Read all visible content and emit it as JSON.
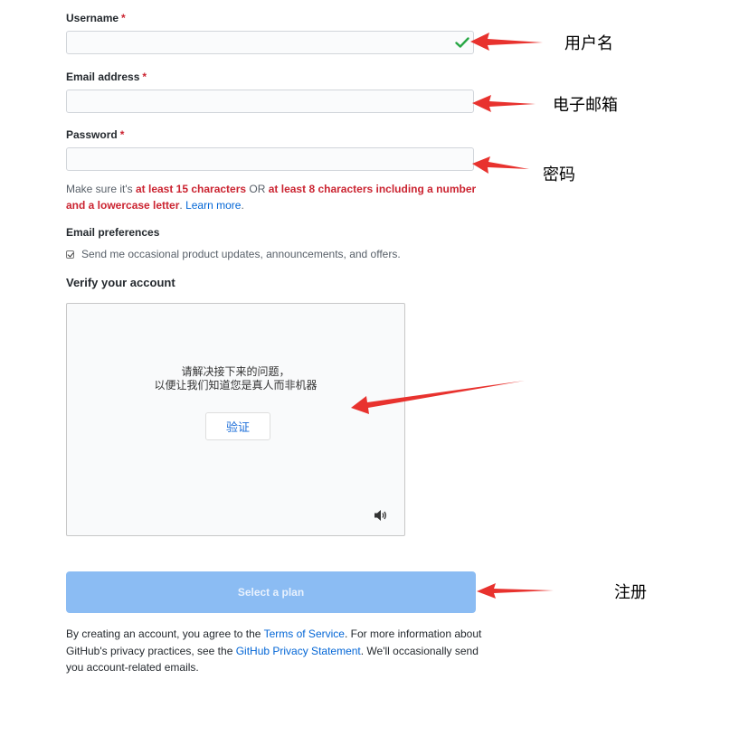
{
  "form": {
    "username": {
      "label": "Username",
      "required_mark": "*",
      "value": "",
      "valid_icon": "checkmark-icon",
      "valid_color": "#28a745"
    },
    "email": {
      "label": "Email address",
      "required_mark": "*",
      "value": ""
    },
    "password": {
      "label": "Password",
      "required_mark": "*",
      "value": "",
      "hint_prefix": "Make sure it's ",
      "hint_rule1": "at least 15 characters",
      "hint_or": " OR ",
      "hint_rule2": "at least 8 characters including a number and a lowercase letter",
      "hint_dot": ". ",
      "hint_link": "Learn more",
      "hint_end": "."
    },
    "email_preferences": {
      "label": "Email preferences",
      "checkbox_checked": true,
      "checkbox_label": "Send me occasional product updates, announcements, and offers."
    },
    "verify": {
      "label": "Verify your account",
      "line1": "请解决接下来的问题，",
      "line2": "以便让我们知道您是真人而非机器",
      "button": "验证",
      "audio_icon": "speaker-icon"
    },
    "submit_label": "Select a plan",
    "legal": {
      "p1": "By creating an account, you agree to the ",
      "tos": "Terms of Service",
      "p2": ". For more information about GitHub's privacy practices, see the ",
      "privacy": "GitHub Privacy Statement",
      "p3": ". We'll occasionally send you account-related emails."
    }
  },
  "annotations": {
    "username": "用户名",
    "email": "电子邮箱",
    "password": "密码",
    "submit": "注册"
  },
  "colors": {
    "required": "#cb2431",
    "link": "#0366d6",
    "button_disabled": "#8bbcf3",
    "arrow": "#e8322e"
  }
}
